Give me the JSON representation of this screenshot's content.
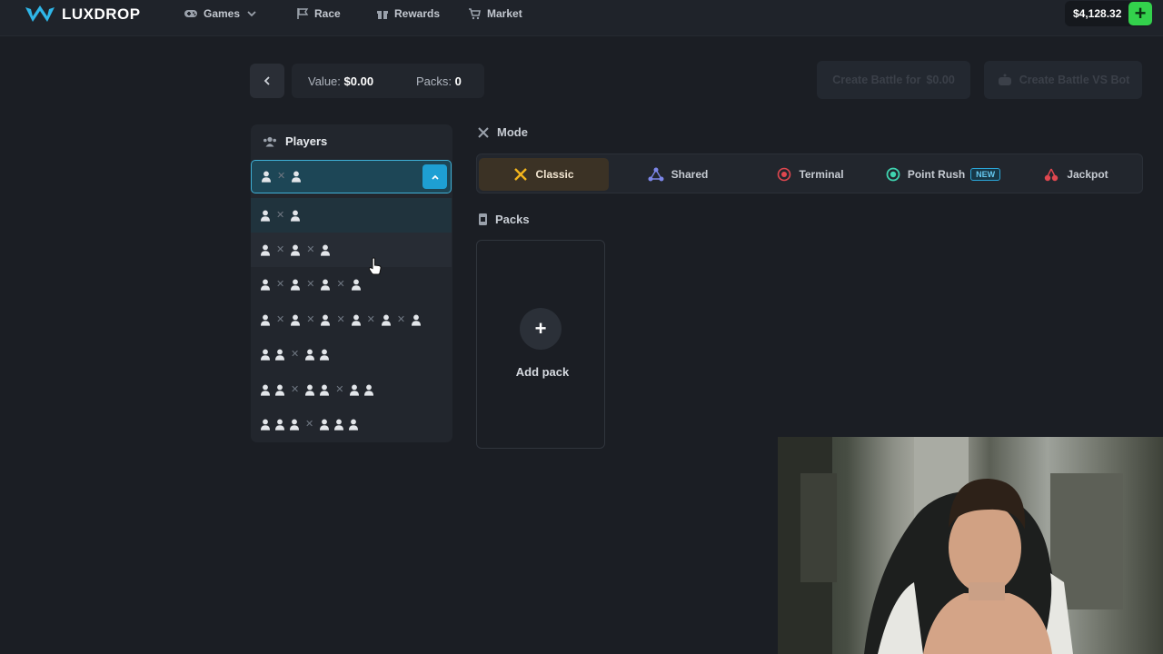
{
  "brand": {
    "name": "LUXDROP",
    "accent": "#2fb6e8"
  },
  "nav": {
    "items": [
      {
        "label": "Games",
        "icon": "gamepad-icon",
        "has_chevron": true
      },
      {
        "label": "Race",
        "icon": "flag-icon"
      },
      {
        "label": "Rewards",
        "icon": "gift-icon"
      },
      {
        "label": "Market",
        "icon": "cart-icon"
      }
    ]
  },
  "wallet": {
    "balance": "$4,128.32",
    "deposit_label": "+",
    "deposit_color": "#33d14c"
  },
  "toolbar": {
    "value_label": "Value:",
    "value": "$0.00",
    "packs_label": "Packs:",
    "packs": "0",
    "create_battle_label": "Create Battle for",
    "create_battle_price": "$0.00",
    "create_bot_label": "Create Battle VS Bot"
  },
  "players": {
    "title": "Players",
    "selected_index": 0,
    "hover_index": 1,
    "options": [
      {
        "teams": [
          1,
          1
        ]
      },
      {
        "teams": [
          1,
          1,
          1
        ]
      },
      {
        "teams": [
          1,
          1,
          1,
          1
        ]
      },
      {
        "teams": [
          1,
          1,
          1,
          1,
          1,
          1
        ]
      },
      {
        "teams": [
          2,
          2
        ]
      },
      {
        "teams": [
          2,
          2,
          2
        ]
      },
      {
        "teams": [
          3,
          3
        ]
      }
    ]
  },
  "mode": {
    "title": "Mode",
    "items": [
      {
        "label": "Classic",
        "icon": "swords-icon",
        "active": true
      },
      {
        "label": "Shared",
        "icon": "share-icon"
      },
      {
        "label": "Terminal",
        "icon": "target-icon"
      },
      {
        "label": "Point Rush",
        "icon": "point-icon",
        "badge": "NEW"
      },
      {
        "label": "Jackpot",
        "icon": "cherry-icon"
      }
    ]
  },
  "packs": {
    "title": "Packs",
    "add_label": "Add pack",
    "add_icon": "+"
  }
}
